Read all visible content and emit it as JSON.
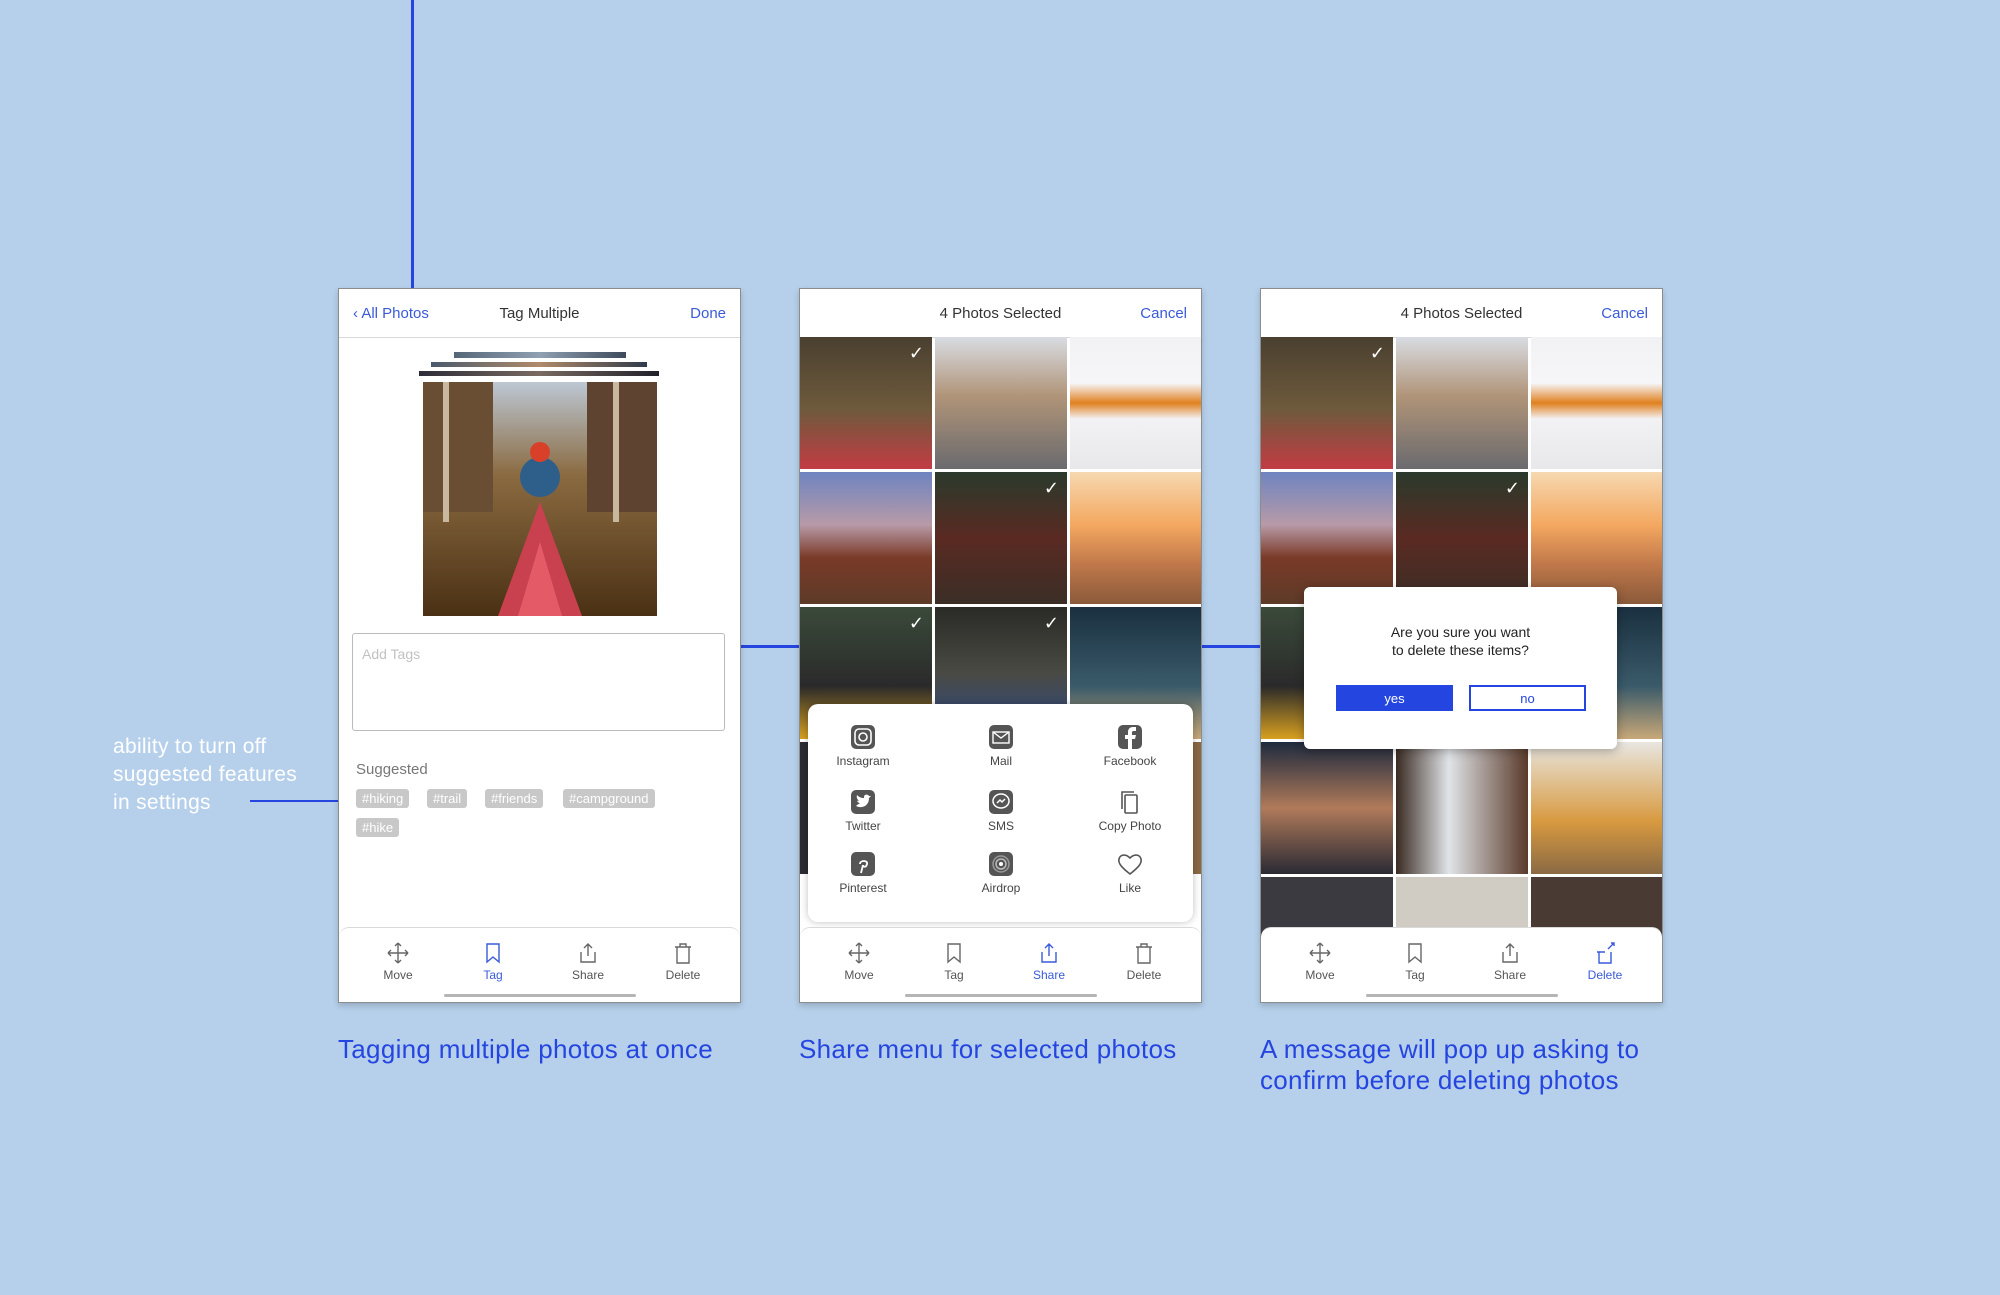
{
  "annotation": {
    "lines": [
      "ability to turn off",
      "suggested features",
      "in settings"
    ]
  },
  "screen1": {
    "back_label": "All Photos",
    "title": "Tag Multiple",
    "done_label": "Done",
    "tag_input_placeholder": "Add Tags",
    "suggested_label": "Suggested",
    "suggested_tags": [
      "#hiking",
      "#trail",
      "#friends",
      "#campground",
      "#hike"
    ],
    "caption": "Tagging multiple photos at once"
  },
  "screen2": {
    "title": "4 Photos Selected",
    "cancel_label": "Cancel",
    "share_items": [
      {
        "label": "Instagram",
        "icon": "instagram-icon"
      },
      {
        "label": "Mail",
        "icon": "mail-icon"
      },
      {
        "label": "Facebook",
        "icon": "facebook-icon"
      },
      {
        "label": "Twitter",
        "icon": "twitter-icon"
      },
      {
        "label": "SMS",
        "icon": "messenger-icon"
      },
      {
        "label": "Copy Photo",
        "icon": "copy-icon"
      },
      {
        "label": "Pinterest",
        "icon": "pinterest-icon"
      },
      {
        "label": "Airdrop",
        "icon": "airdrop-icon"
      },
      {
        "label": "Like",
        "icon": "heart-icon"
      }
    ],
    "caption": "Share menu for selected photos"
  },
  "screen3": {
    "title": "4 Photos Selected",
    "cancel_label": "Cancel",
    "dialog_line1": "Are you sure you want",
    "dialog_line2": "to delete these items?",
    "yes_label": "yes",
    "no_label": "no",
    "caption_line1": "A message will pop up asking to",
    "caption_line2": "confirm before deleting photos"
  },
  "tabbar": {
    "move": "Move",
    "tag": "Tag",
    "share": "Share",
    "delete": "Delete"
  },
  "colors": {
    "background": "#b6d0eb",
    "accent": "#2545e0",
    "link": "#3a5ad9",
    "annotation_text": "#ffffff"
  },
  "selection_check": "✓"
}
